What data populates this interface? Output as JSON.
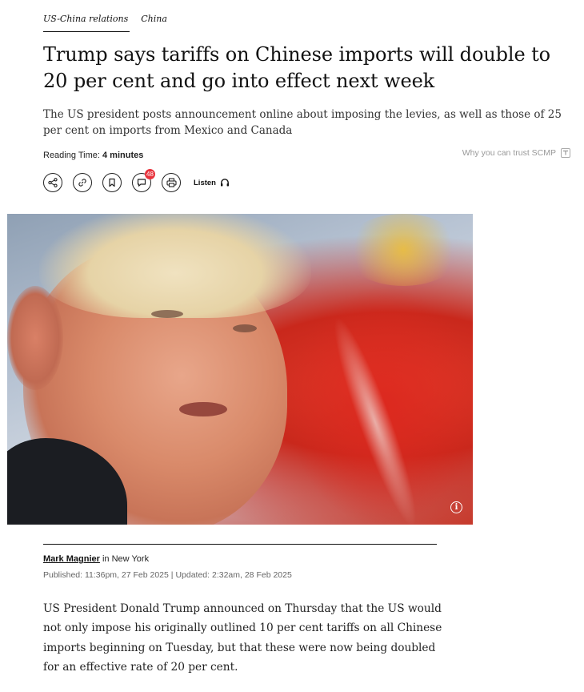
{
  "tags": {
    "primary": "US-China relations",
    "secondary": "China"
  },
  "headline": "Trump says tariffs on Chinese imports will double to 20 per cent and go into effect next week",
  "subheadline": "The US president posts announcement online about imposing the levies, as well as those of 25 per cent on imports from Mexico and Canada",
  "reading_time": {
    "label": "Reading Time:",
    "value": "4 minutes"
  },
  "trust_link": "Why you can trust SCMP",
  "toolbar": {
    "comment_count": "48",
    "listen_label": "Listen",
    "icons": [
      "share-icon",
      "link-icon",
      "bookmark-icon",
      "comment-icon",
      "print-icon",
      "headphones-icon"
    ]
  },
  "hero_image": {
    "info_glyph": "i"
  },
  "byline": {
    "author": "Mark Magnier",
    "location_prefix": "in",
    "location": "New York"
  },
  "dates": {
    "published_label": "Published:",
    "published": "11:36pm, 27 Feb 2025",
    "separator": "|",
    "updated_label": "Updated:",
    "updated": "2:32am, 28 Feb 2025"
  },
  "body": {
    "paragraph_1": "US President Donald Trump announced on Thursday that the US would not only impose his originally outlined 10 per cent tariffs on all Chinese imports beginning on Tuesday, but that these were now being doubled for an effective rate of 20 per cent."
  }
}
